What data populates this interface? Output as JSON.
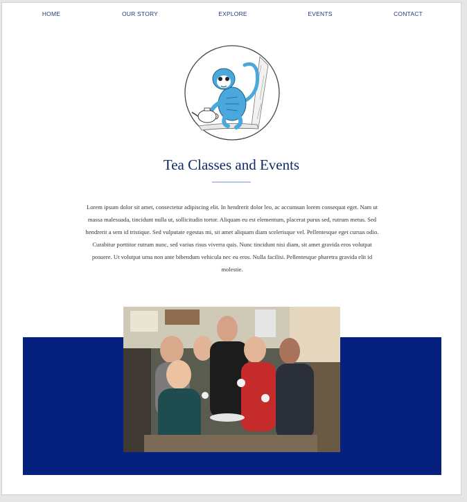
{
  "nav": {
    "items": [
      {
        "label": "HOME"
      },
      {
        "label": "OUR STORY"
      },
      {
        "label": "EXPLORE"
      },
      {
        "label": "EVENTS"
      },
      {
        "label": "CONTACT"
      }
    ]
  },
  "logo": {
    "icon": "monkey-teapot-icon"
  },
  "main": {
    "title": "Tea Classes and Events",
    "body": "Lorem ipsum dolor sit amet, consectetur adipiscing elit. In hendrerit dolor leo, ac accumsan lorem consequat eget. Nam ut massa malesuada, tincidunt nulla ut, sollicitudin tortor. Aliquam eu est elementum, placerat purus sed, rutrum metus. Sed hendrerit a sem id tristique. Sed vulputate egestas mi, sit amet aliquam diam scelerisque vel. Pellentesque eget cursus odio. Curabitur porttitor rutrum nunc, sed varius risus viverra quis. Nunc tincidunt nisi diam, sit amet gravida eros volutpat posuere. Ut volutpat urna non ante bibendum vehicula nec eu eros. Nulla facilisi. Pellentesque pharetra gravida elit id molestie."
  },
  "colors": {
    "nav_text": "#1f3a78",
    "title": "#0d2a66",
    "band": "#05207f",
    "monkey": "#4aa8dd"
  }
}
